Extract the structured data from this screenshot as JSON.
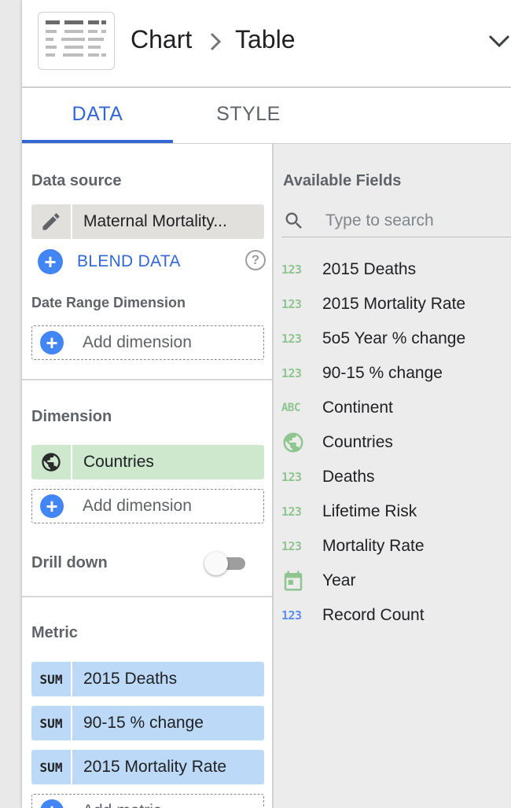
{
  "header": {
    "crumb_chart": "Chart",
    "crumb_table": "Table"
  },
  "tabs": [
    {
      "label": "DATA",
      "active": true
    },
    {
      "label": "STYLE",
      "active": false
    }
  ],
  "left": {
    "data_source_title": "Data source",
    "data_source_value": "Maternal Mortality...",
    "blend_label": "BLEND DATA",
    "help_glyph": "?",
    "date_range_title": "Date Range Dimension",
    "add_dimension_label": "Add dimension",
    "dimension_title": "Dimension",
    "dimension_value": "Countries",
    "add_dimension_label_2": "Add dimension",
    "drill_down_title": "Drill down",
    "drill_down_on": false,
    "metric_title": "Metric",
    "agg_label": "SUM",
    "metrics": [
      {
        "agg": "SUM",
        "label": "2015 Deaths"
      },
      {
        "agg": "SUM",
        "label": "90-15 % change"
      },
      {
        "agg": "SUM",
        "label": "2015 Mortality Rate"
      }
    ],
    "add_metric_label": "Add metric"
  },
  "right": {
    "title": "Available Fields",
    "search_placeholder": "Type to search",
    "fields": [
      {
        "type": "number",
        "icon": "123",
        "label": "2015 Deaths"
      },
      {
        "type": "number",
        "icon": "123",
        "label": "2015 Mortality Rate"
      },
      {
        "type": "number",
        "icon": "123",
        "label": "5o5 Year % change"
      },
      {
        "type": "number",
        "icon": "123",
        "label": "90-15 % change"
      },
      {
        "type": "text",
        "icon": "ABC",
        "label": "Continent"
      },
      {
        "type": "geo",
        "icon": "globe-icon",
        "label": "Countries"
      },
      {
        "type": "number",
        "icon": "123",
        "label": "Deaths"
      },
      {
        "type": "number",
        "icon": "123",
        "label": "Lifetime Risk"
      },
      {
        "type": "number",
        "icon": "123",
        "label": "Mortality Rate"
      },
      {
        "type": "date",
        "icon": "calendar-icon",
        "label": "Year"
      },
      {
        "type": "metric",
        "icon": "123",
        "label": "Record Count"
      }
    ]
  },
  "colors": {
    "accent_blue": "#3367d6",
    "field_green": "#8fc58f",
    "field_blue": "#5b8dee",
    "dimension_chip": "#cde8cd",
    "metric_chip": "#bcdaf7",
    "datasource_chip": "#e2e0dd"
  }
}
